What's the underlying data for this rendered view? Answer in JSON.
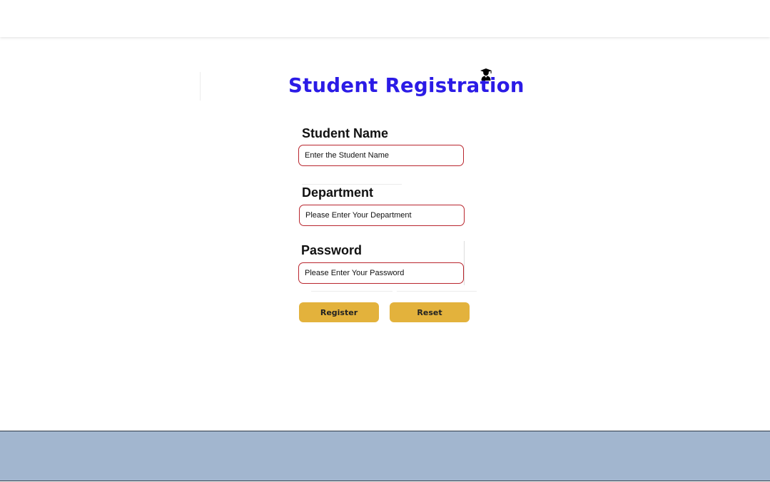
{
  "page": {
    "title": "Student Registration",
    "title_icon": "graduate-student-icon"
  },
  "form": {
    "student_name": {
      "label": "Student Name",
      "placeholder": "Enter the Student Name"
    },
    "department": {
      "label": "Department",
      "placeholder": "Please Enter Your Department"
    },
    "password": {
      "label": "Password",
      "placeholder": "Please Enter Your Password"
    },
    "buttons": {
      "register": "Register",
      "reset": "Reset"
    }
  },
  "colors": {
    "title": "#2b1be6",
    "field_border": "#b9262e",
    "button": "#e3b23c",
    "footer": "#a2b6cf"
  }
}
